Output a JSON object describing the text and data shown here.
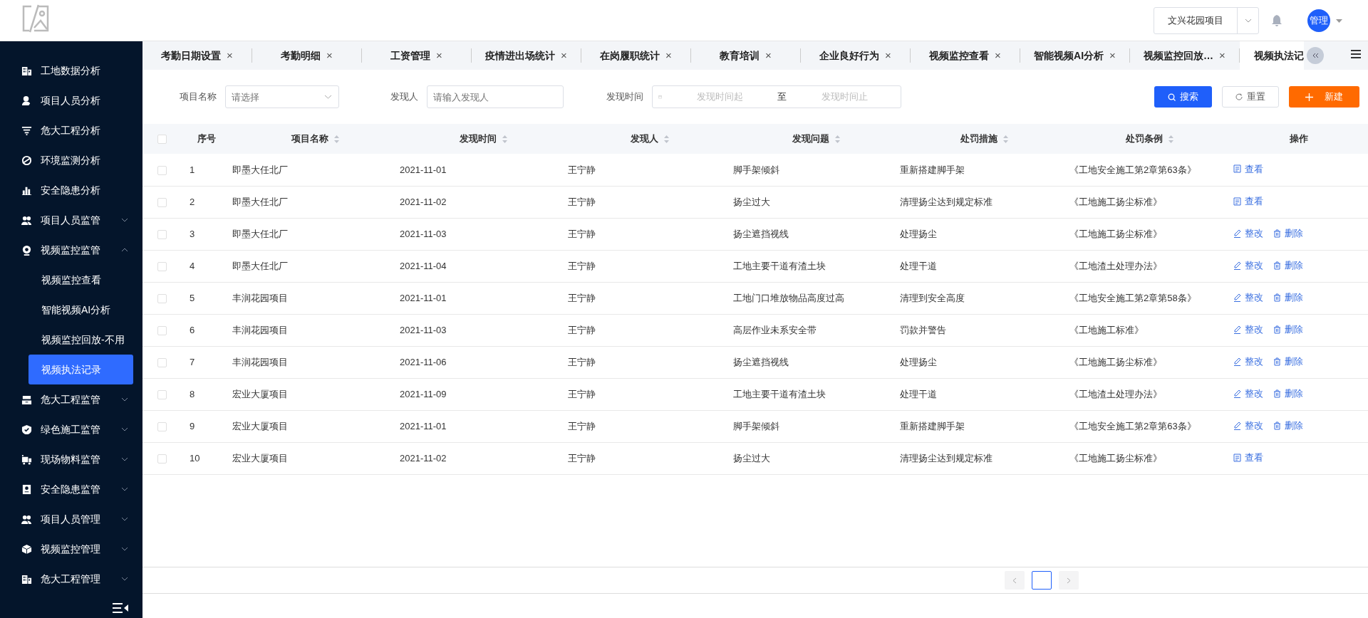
{
  "header": {
    "project_select": {
      "value": "文兴花园项目"
    },
    "avatar": {
      "label": "管理"
    }
  },
  "sidebar": {
    "items": [
      {
        "label": "工地数据分析",
        "expandable": false
      },
      {
        "label": "项目人员分析",
        "expandable": false
      },
      {
        "label": "危大工程分析",
        "expandable": false
      },
      {
        "label": "环境监测分析",
        "expandable": false
      },
      {
        "label": "安全隐患分析",
        "expandable": false
      },
      {
        "label": "项目人员监管",
        "expandable": true,
        "expanded": false
      },
      {
        "label": "视频监控监管",
        "expandable": true,
        "expanded": true,
        "children": [
          {
            "label": "视频监控查看",
            "selected": false
          },
          {
            "label": "智能视频AI分析",
            "selected": false
          },
          {
            "label": "视频监控回放-不用",
            "selected": false
          },
          {
            "label": "视频执法记录",
            "selected": true
          }
        ]
      },
      {
        "label": "危大工程监管",
        "expandable": true,
        "expanded": false
      },
      {
        "label": "绿色施工监管",
        "expandable": true,
        "expanded": false
      },
      {
        "label": "现场物料监管",
        "expandable": true,
        "expanded": false
      },
      {
        "label": "安全隐患监管",
        "expandable": true,
        "expanded": false
      },
      {
        "label": "项目人员管理",
        "expandable": true,
        "expanded": false
      },
      {
        "label": "视频监控管理",
        "expandable": true,
        "expanded": false
      },
      {
        "label": "危大工程管理",
        "expandable": true,
        "expanded": false
      }
    ]
  },
  "tabs": [
    {
      "label": "考勤日期设置",
      "selected": false,
      "close": "×"
    },
    {
      "label": "考勤明细",
      "selected": false,
      "close": "×"
    },
    {
      "label": "工资管理",
      "selected": false,
      "close": "×"
    },
    {
      "label": "疫情进出场统计",
      "selected": false,
      "close": "×"
    },
    {
      "label": "在岗履职统计",
      "selected": false,
      "close": "×"
    },
    {
      "label": "教育培训",
      "selected": false,
      "close": "×"
    },
    {
      "label": "企业良好行为",
      "selected": false,
      "close": "×"
    },
    {
      "label": "视频监控查看",
      "selected": false,
      "close": "×"
    },
    {
      "label": "智能视频AI分析",
      "selected": false,
      "close": "×"
    },
    {
      "label": "视频监控回放…",
      "selected": false,
      "close": "×"
    },
    {
      "label": "视频执法记",
      "selected": true
    }
  ],
  "filters": {
    "project": {
      "label": "项目名称",
      "placeholder": "请选择"
    },
    "finder": {
      "label": "发现人",
      "placeholder": "请输入发现人"
    },
    "time": {
      "label": "发现时间",
      "start_placeholder": "发现时间起",
      "separator": "至",
      "end_placeholder": "发现时间止"
    },
    "buttons": [
      {
        "kind": "search",
        "label": "搜索"
      },
      {
        "kind": "reset",
        "label": "重置"
      },
      {
        "kind": "new",
        "label": "新建"
      }
    ]
  },
  "table": {
    "select_all": {
      "checked": false
    },
    "columns": [
      {
        "label": "序号",
        "sortable": false
      },
      {
        "label": "项目名称",
        "sortable": true
      },
      {
        "label": "发现时间",
        "sortable": true
      },
      {
        "label": "发现人",
        "sortable": true
      },
      {
        "label": "发现问题",
        "sortable": true
      },
      {
        "label": "处罚措施",
        "sortable": true
      },
      {
        "label": "处罚条例",
        "sortable": true
      },
      {
        "label": "操作",
        "sortable": false
      }
    ],
    "rows": [
      {
        "checked": false,
        "cells": [
          "1",
          "即墨大任北厂",
          "2021-11-01",
          "王宁静",
          "脚手架倾斜",
          "重新搭建脚手架",
          "《工地安全施工第2章第63条》"
        ],
        "actions": [
          {
            "kind": "view",
            "label": "查看"
          }
        ]
      },
      {
        "checked": false,
        "cells": [
          "2",
          "即墨大任北厂",
          "2021-11-02",
          "王宁静",
          "扬尘过大",
          "清理扬尘达到规定标准",
          "《工地施工扬尘标准》"
        ],
        "actions": [
          {
            "kind": "view",
            "label": "查看"
          }
        ]
      },
      {
        "checked": false,
        "cells": [
          "3",
          "即墨大任北厂",
          "2021-11-03",
          "王宁静",
          "扬尘遮挡视线",
          "处理扬尘",
          "《工地施工扬尘标准》"
        ],
        "actions": [
          {
            "kind": "edit",
            "label": "整改"
          },
          {
            "kind": "delete",
            "label": "删除"
          }
        ]
      },
      {
        "checked": false,
        "cells": [
          "4",
          "即墨大任北厂",
          "2021-11-04",
          "王宁静",
          "工地主要干道有渣土块",
          "处理干道",
          "《工地渣土处理办法》"
        ],
        "actions": [
          {
            "kind": "edit",
            "label": "整改"
          },
          {
            "kind": "delete",
            "label": "删除"
          }
        ]
      },
      {
        "checked": false,
        "cells": [
          "5",
          "丰润花园项目",
          "2021-11-01",
          "王宁静",
          "工地门口堆放物品高度过高",
          "清理到安全高度",
          "《工地安全施工第2章第58条》"
        ],
        "actions": [
          {
            "kind": "edit",
            "label": "整改"
          },
          {
            "kind": "delete",
            "label": "删除"
          }
        ]
      },
      {
        "checked": false,
        "cells": [
          "6",
          "丰润花园项目",
          "2021-11-03",
          "王宁静",
          "高层作业未系安全带",
          "罚款并警告",
          "《工地施工标准》"
        ],
        "actions": [
          {
            "kind": "edit",
            "label": "整改"
          },
          {
            "kind": "delete",
            "label": "删除"
          }
        ]
      },
      {
        "checked": false,
        "cells": [
          "7",
          "丰润花园项目",
          "2021-11-06",
          "王宁静",
          "扬尘遮挡视线",
          "处理扬尘",
          "《工地施工扬尘标准》"
        ],
        "actions": [
          {
            "kind": "edit",
            "label": "整改"
          },
          {
            "kind": "delete",
            "label": "删除"
          }
        ]
      },
      {
        "checked": false,
        "cells": [
          "8",
          "宏业大厦项目",
          "2021-11-09",
          "王宁静",
          "工地主要干道有渣土块",
          "处理干道",
          "《工地渣土处理办法》"
        ],
        "actions": [
          {
            "kind": "edit",
            "label": "整改"
          },
          {
            "kind": "delete",
            "label": "删除"
          }
        ]
      },
      {
        "checked": false,
        "cells": [
          "9",
          "宏业大厦项目",
          "2021-11-01",
          "王宁静",
          "脚手架倾斜",
          "重新搭建脚手架",
          "《工地安全施工第2章第63条》"
        ],
        "actions": [
          {
            "kind": "edit",
            "label": "整改"
          },
          {
            "kind": "delete",
            "label": "删除"
          }
        ]
      },
      {
        "checked": false,
        "cells": [
          "10",
          "宏业大厦项目",
          "2021-11-02",
          "王宁静",
          "扬尘过大",
          "清理扬尘达到规定标准",
          "《工地施工扬尘标准》"
        ],
        "actions": [
          {
            "kind": "view",
            "label": "查看"
          }
        ]
      }
    ]
  }
}
